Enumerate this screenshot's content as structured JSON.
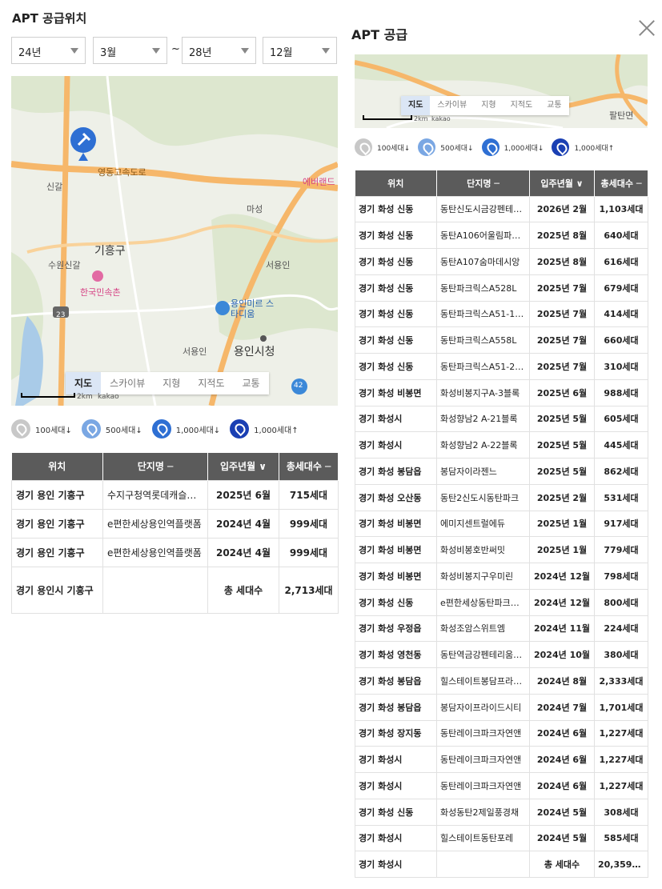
{
  "left": {
    "title": "APT 공급위치",
    "selects": {
      "from_year": "24년",
      "from_month": "3월",
      "to_year": "28년",
      "to_month": "12월",
      "tilde": "~"
    },
    "map": {
      "labels": [
        "영동고속도로",
        "신갈",
        "마성",
        "기흥구",
        "수원신갈",
        "한국민속촌",
        "서용인",
        "용인미르 스타디움",
        "서용인",
        "용인시청",
        "에버랜드",
        "23",
        "42"
      ],
      "tabs": [
        "지도",
        "스카이뷰",
        "지형",
        "지적도",
        "교통"
      ],
      "scale": "2km",
      "brand": "kakao"
    },
    "legend": [
      "100세대↓",
      "500세대↓",
      "1,000세대↓",
      "1,000세대↑"
    ],
    "table": {
      "headers": [
        "위치",
        "단지명 ─",
        "입주년월 ∨",
        "총세대수 ─"
      ],
      "rows": [
        [
          "경기 용인 기흥구",
          "수지구청역롯데캐슬하이",
          "2025년 6월",
          "715세대"
        ],
        [
          "경기 용인 기흥구",
          "e편한세상용인역플랫폼",
          "2024년 4월",
          "999세대"
        ],
        [
          "경기 용인 기흥구",
          "e편한세상용인역플랫폼",
          "2024년 4월",
          "999세대"
        ]
      ],
      "total": {
        "location": "경기 용인시 기흥구",
        "label": "총 세대수",
        "value": "2,713세대"
      }
    }
  },
  "right": {
    "title": "APT 공급",
    "map": {
      "tabs": [
        "지도",
        "스카이뷰",
        "지형",
        "지적도",
        "교통"
      ],
      "label": "팔탄면",
      "scale": "2km",
      "brand": "kakao"
    },
    "legend": [
      "100세대↓",
      "500세대↓",
      "1,000세대↓",
      "1,000세대↑"
    ],
    "table": {
      "headers": [
        "위치",
        "단지명 ─",
        "입주년월 ∨",
        "총세대수 ─"
      ],
      "rows": [
        [
          "경기 화성 신동",
          "동탄신도시금강펜테리움",
          "2026년 2월",
          "1,103세대"
        ],
        [
          "경기 화성 신동",
          "동탄A106어울림파밀리에",
          "2025년 8월",
          "640세대"
        ],
        [
          "경기 화성 신동",
          "동탄A107숨마데시앙",
          "2025년 8월",
          "616세대"
        ],
        [
          "경기 화성 신동",
          "동탄파크릭스A528L",
          "2025년 7월",
          "679세대"
        ],
        [
          "경기 화성 신동",
          "동탄파크릭스A51-1블록",
          "2025년 7월",
          "414세대"
        ],
        [
          "경기 화성 신동",
          "동탄파크릭스A558L",
          "2025년 7월",
          "660세대"
        ],
        [
          "경기 화성 신동",
          "동탄파크릭스A51-2블록",
          "2025년 7월",
          "310세대"
        ],
        [
          "경기 화성 비봉면",
          "화성비봉지구A-3블록",
          "2025년 6월",
          "988세대"
        ],
        [
          "경기 화성시",
          "화성향남2 A-21블록",
          "2025년 5월",
          "605세대"
        ],
        [
          "경기 화성시",
          "화성향남2 A-22블록",
          "2025년 5월",
          "445세대"
        ],
        [
          "경기 화성 봉담읍",
          "봉담자이라젠느",
          "2025년 5월",
          "862세대"
        ],
        [
          "경기 화성 오산동",
          "동탄2신도시동탄파크",
          "2025년 2월",
          "531세대"
        ],
        [
          "경기 화성 비봉면",
          "에미지센트럴에듀",
          "2025년 1월",
          "917세대"
        ],
        [
          "경기 화성 비봉면",
          "화성비봉호반써밋",
          "2025년 1월",
          "779세대"
        ],
        [
          "경기 화성 비봉면",
          "화성비봉지구우미린",
          "2024년 12월",
          "798세대"
        ],
        [
          "경기 화성 신동",
          "e편한세상동탄파크아너스",
          "2024년 12월",
          "800세대"
        ],
        [
          "경기 화성 우정읍",
          "화성조암스위트엠",
          "2024년 11월",
          "224세대"
        ],
        [
          "경기 화성 영천동",
          "동탄역금강펜테리움센트럴",
          "2024년 10월",
          "380세대"
        ],
        [
          "경기 화성 봉담읍",
          "힐스테이트봉담프라이머",
          "2024년 8월",
          "2,333세대"
        ],
        [
          "경기 화성 봉담읍",
          "봉담자이프라이드시티",
          "2024년 7월",
          "1,701세대"
        ],
        [
          "경기 화성 장지동",
          "동탄레이크파크자연앤",
          "2024년 6월",
          "1,227세대"
        ],
        [
          "경기 화성시",
          "동탄레이크파크자연앤",
          "2024년 6월",
          "1,227세대"
        ],
        [
          "경기 화성시",
          "동탄레이크파크자연앤",
          "2024년 6월",
          "1,227세대"
        ],
        [
          "경기 화성 신동",
          "화성동탄2제일풍경채",
          "2024년 5월",
          "308세대"
        ],
        [
          "경기 화성시",
          "힐스테이트동탄포레",
          "2024년 5월",
          "585세대"
        ]
      ],
      "total": {
        "location": "경기 화성시",
        "label": "총 세대수",
        "value": "20,359세대"
      }
    }
  },
  "colors": {
    "header_bg": "#5b5b5b",
    "pin_100": "#c8c8c8",
    "pin_500": "#7aa7e3",
    "pin_1000": "#2e6fd3",
    "pin_1000_up": "#1a3fb3",
    "road": "#f6b76a"
  }
}
